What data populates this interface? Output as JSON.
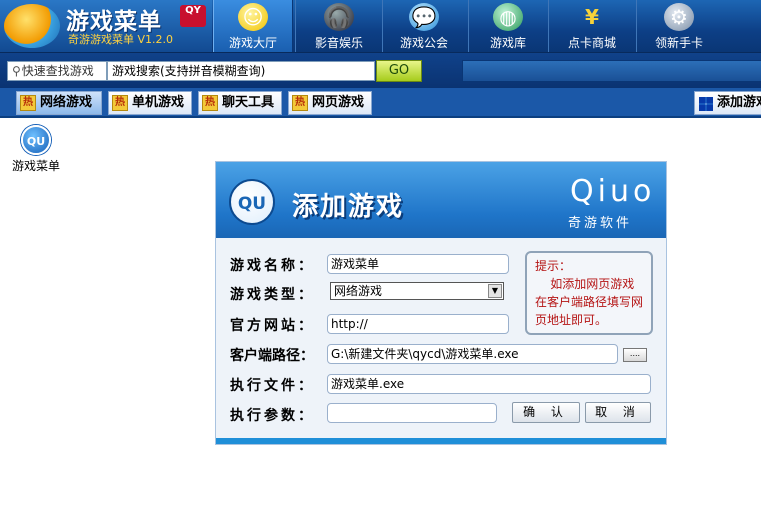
{
  "app": {
    "title": "游戏菜单",
    "badge": "QY",
    "version": "奇游游戏菜单 V1.2.0"
  },
  "nav": [
    {
      "label": "游戏大厅",
      "icon": "smiley-icon",
      "active": true
    },
    {
      "label": "影音娱乐",
      "icon": "headphones-icon",
      "active": false
    },
    {
      "label": "游戏公会",
      "icon": "chat-bubble-icon",
      "active": false
    },
    {
      "label": "游戏库",
      "icon": "globe-icon",
      "active": false
    },
    {
      "label": "点卡商城",
      "icon": "yen-icon",
      "active": false
    },
    {
      "label": "领新手卡",
      "icon": "gear-icon",
      "active": false
    }
  ],
  "search": {
    "quick_label": "快速查找游戏",
    "query": "游戏搜索(支持拼音模糊查询)",
    "go_label": "GO"
  },
  "tabs": [
    {
      "label": "网络游戏",
      "active": true
    },
    {
      "label": "单机游戏",
      "active": false
    },
    {
      "label": "聊天工具",
      "active": false
    },
    {
      "label": "网页游戏",
      "active": false
    }
  ],
  "tab_hot": "热",
  "add_tab": "添加游戏",
  "desktop": {
    "icon_text": "QU",
    "icon_label": "游戏菜单"
  },
  "dialog": {
    "logo_text": "QU",
    "title": "添加游戏",
    "brand": "Qiuo",
    "brand_sub": "奇游软件",
    "fields": {
      "name_label": "游戏名称：",
      "name_value": "游戏菜单",
      "type_label": "游戏类型：",
      "type_value": "网络游戏",
      "site_label": "官方网站：",
      "site_value": "http://",
      "client_label": "客户端路径：",
      "client_value": "G:\\新建文件夹\\qycd\\游戏菜单.exe",
      "exe_label": "执行文件：",
      "exe_value": "游戏菜单.exe",
      "args_label": "执行参数：",
      "args_value": ""
    },
    "tip": "提示：\n    如添加网页游戏在客户端路径填写网页地址即可。",
    "browse_label": "....",
    "ok_label": "确 认",
    "cancel_label": "取 消"
  }
}
